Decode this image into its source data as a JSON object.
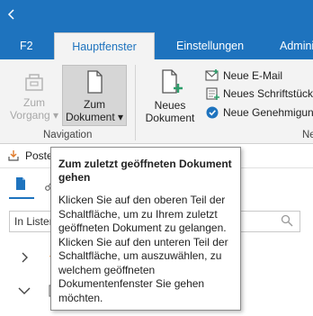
{
  "tabs": [
    {
      "label": "F2"
    },
    {
      "label": "Hauptfenster"
    },
    {
      "label": "Einstellungen"
    },
    {
      "label": "Admini"
    }
  ],
  "ribbon": {
    "navigation": {
      "back_label": "Zum",
      "back_label2": "Vorgang",
      "doc_label": "Zum",
      "doc_label2": "Dokument",
      "group_label": "Navigation"
    },
    "new_doc": {
      "label": "Neues",
      "label2": "Dokument"
    },
    "small_items": [
      {
        "label": "Neue E-Mail"
      },
      {
        "label": "Neues Schriftstück"
      },
      {
        "label": "Neue Genehmigung"
      }
    ],
    "group_label_right": "Ne"
  },
  "pane": {
    "header_text": "Postein",
    "search_value": "In Listen s"
  },
  "tooltip": {
    "title": "Zum zuletzt geöffneten Dokument gehen",
    "body": "Klicken Sie auf den oberen Teil der Schaltfläche, um zu Ihrem zuletzt geöffneten Dokument zu gelangen. Klicken Sie auf den unteren Teil der Schaltfläche, um auszuwählen, zu welchem geöffneten Dokumentenfenster Sie gehen möchten."
  },
  "colors": {
    "accent": "#1e73be",
    "ribbon_bg": "#f3f3f3",
    "star": "#e07b2a"
  }
}
